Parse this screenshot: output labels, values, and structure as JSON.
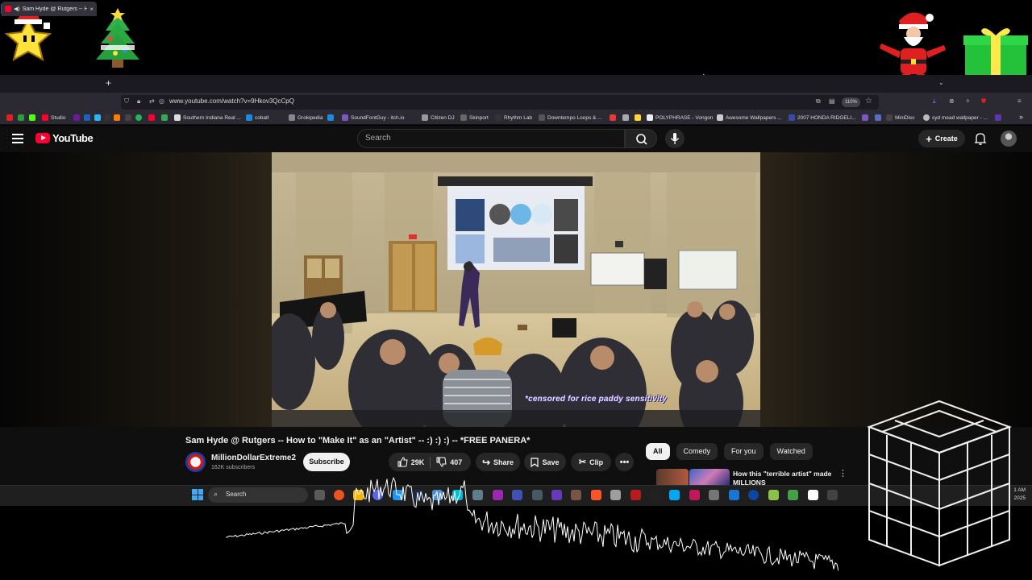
{
  "browser": {
    "tab_title": "Sam Hyde @ Rutgers -- How",
    "tab_close": "×",
    "new_tab": "+",
    "url": "www.youtube.com/watch?v=9Hkov3QcCpQ",
    "zoom": "110%",
    "bookmarks": [
      "Studio",
      "Southern Indiana Real ...",
      "cobalt",
      "Grokipedia",
      "SoundFontGuy - itch.io",
      "Citizen DJ",
      "Skinport",
      "Rhythm Lab",
      "Downtempo Loops & ...",
      "POLYPHRASE - Vongon",
      "Awesome Wallpapers ...",
      "2007 HONDA RIDGELI...",
      "MiniDisc",
      "syd mead wallpaper - ..."
    ]
  },
  "youtube": {
    "logo_text": "YouTube",
    "search_placeholder": "Search",
    "create_label": "Create"
  },
  "video": {
    "subtitle": "*censored for rice paddy sensitivity",
    "title": "Sam Hyde @ Rutgers -- How to \"Make It\" as an \"Artist\" -- :) :) :) -- *FREE PANERA*",
    "channel_name": "MillionDollarExtreme2",
    "subscribers": "162K subscribers",
    "subscribe_label": "Subscribe",
    "likes": "29K",
    "dislikes": "407",
    "share_label": "Share",
    "save_label": "Save",
    "clip_label": "Clip"
  },
  "recommendations": {
    "chips": [
      "All",
      "Comedy",
      "For you",
      "Watched"
    ],
    "first_title": "How this \"terrible artist\" made MILLIONS"
  },
  "taskbar": {
    "search_text": "Search",
    "time": "1 AM",
    "year": "2025"
  },
  "colors": {
    "youtube_red": "#ff0033",
    "page_bg": "#0f0f0f",
    "chip_active_bg": "#f1f1f1"
  }
}
